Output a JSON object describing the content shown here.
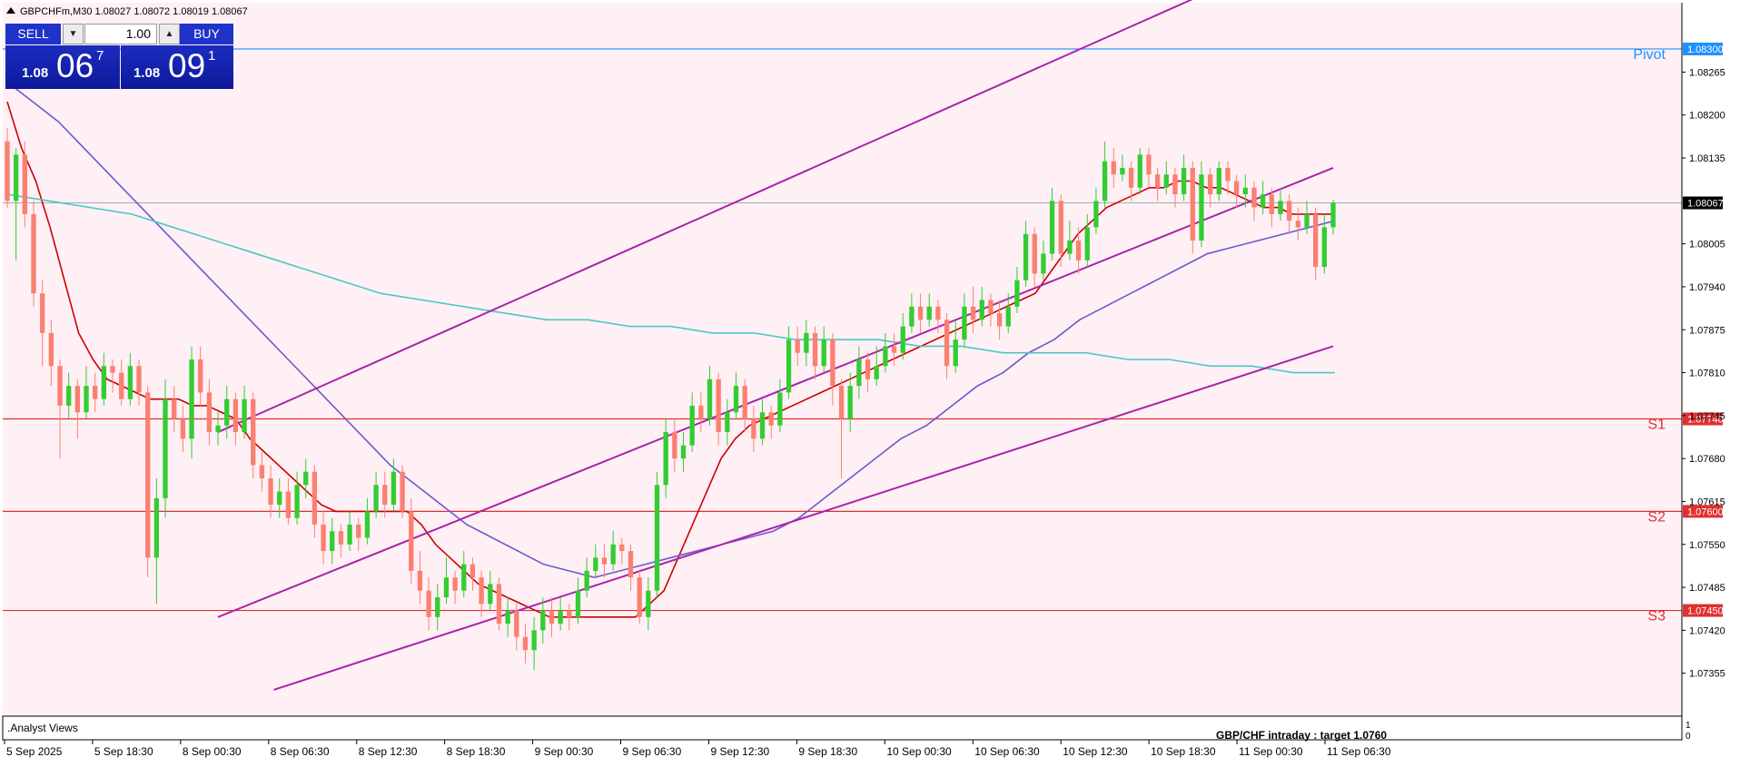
{
  "header": {
    "text": "GBPCHFm,M30  1.08027 1.08072 1.08019 1.08067"
  },
  "trade_panel": {
    "sell_label": "SELL",
    "buy_label": "BUY",
    "lot_value": "1.00",
    "bid_small": "1.08",
    "bid_big": "06",
    "bid_super": "7",
    "ask_small": "1.08",
    "ask_big": "09",
    "ask_super": "1"
  },
  "indicator_panel": {
    "title": ".Analyst Views",
    "annotation": "GBP/CHF intraday :   target 1.0760",
    "scale_top": "1",
    "scale_bottom": "0"
  },
  "colors": {
    "background": "#fff0f5",
    "bull": "#32cd32",
    "bear": "#fa8072",
    "ma_fast": "#cc0000",
    "ma_mid": "#6a5acd",
    "ma_slow": "#48c9c2",
    "channel": "#aa22aa",
    "level": "#e03030",
    "pivot": "#1e90ff",
    "grid": "#a0b0a8"
  },
  "chart_data": {
    "type": "candlestick",
    "symbol": "GBPCHFm,M30",
    "ylim": [
      1.0729,
      1.0837
    ],
    "y_ticks": [
      "1.08265",
      "1.08200",
      "1.08135",
      "1.08005",
      "1.07940",
      "1.07875",
      "1.07810",
      "1.07745",
      "1.07680",
      "1.07615",
      "1.07550",
      "1.07485",
      "1.07420",
      "1.07355"
    ],
    "x_ticks": [
      "5 Sep 2025",
      "5 Sep 18:30",
      "8 Sep 00:30",
      "8 Sep 06:30",
      "8 Sep 12:30",
      "8 Sep 18:30",
      "9 Sep 00:30",
      "9 Sep 06:30",
      "9 Sep 12:30",
      "9 Sep 18:30",
      "10 Sep 00:30",
      "10 Sep 06:30",
      "10 Sep 12:30",
      "10 Sep 18:30",
      "11 Sep 00:30",
      "11 Sep 06:30"
    ],
    "levels": [
      {
        "name": "Pivot",
        "value": 1.083,
        "label": "1.08300"
      },
      {
        "name": "S1",
        "value": 1.0774,
        "label": "1.07740"
      },
      {
        "name": "S2",
        "value": 1.076,
        "label": "1.07600"
      },
      {
        "name": "S3",
        "value": 1.0745,
        "label": "1.07450"
      }
    ],
    "current_price": {
      "value": 1.08067,
      "label": "1.08067"
    },
    "candles": [
      [
        1.0816,
        1.0807,
        1.0818,
        1.0806
      ],
      [
        1.0807,
        1.0814,
        1.0815,
        1.0798
      ],
      [
        1.0814,
        1.0805,
        1.0816,
        1.0803
      ],
      [
        1.0805,
        1.0793,
        1.0807,
        1.0791
      ],
      [
        1.0793,
        1.0787,
        1.0795,
        1.0782
      ],
      [
        1.0787,
        1.0782,
        1.0789,
        1.0779
      ],
      [
        1.0782,
        1.0776,
        1.0783,
        1.0768
      ],
      [
        1.0776,
        1.0779,
        1.0781,
        1.0774
      ],
      [
        1.0779,
        1.0775,
        1.078,
        1.0771
      ],
      [
        1.0775,
        1.0779,
        1.0782,
        1.0774
      ],
      [
        1.0779,
        1.0777,
        1.0781,
        1.0775
      ],
      [
        1.0777,
        1.0782,
        1.0784,
        1.0776
      ],
      [
        1.0782,
        1.0781,
        1.0783,
        1.0778
      ],
      [
        1.0781,
        1.0777,
        1.0783,
        1.0776
      ],
      [
        1.0777,
        1.0782,
        1.0784,
        1.0776
      ],
      [
        1.0782,
        1.0778,
        1.0783,
        1.0776
      ],
      [
        1.0778,
        1.0753,
        1.0779,
        1.075
      ],
      [
        1.0753,
        1.0762,
        1.0765,
        1.0746
      ],
      [
        1.0762,
        1.0777,
        1.078,
        1.0759
      ],
      [
        1.0777,
        1.0774,
        1.0779,
        1.0772
      ],
      [
        1.0774,
        1.0771,
        1.0776,
        1.0769
      ],
      [
        1.0771,
        1.0783,
        1.0785,
        1.0768
      ],
      [
        1.0783,
        1.0778,
        1.0785,
        1.0776
      ],
      [
        1.0778,
        1.0772,
        1.078,
        1.077
      ],
      [
        1.0772,
        1.0773,
        1.0775,
        1.077
      ],
      [
        1.0773,
        1.0777,
        1.0779,
        1.0771
      ],
      [
        1.0777,
        1.0772,
        1.0778,
        1.077
      ],
      [
        1.0772,
        1.0777,
        1.0779,
        1.0771
      ],
      [
        1.0777,
        1.0767,
        1.0778,
        1.0765
      ],
      [
        1.0767,
        1.0765,
        1.0769,
        1.0763
      ],
      [
        1.0765,
        1.0761,
        1.0767,
        1.0759
      ],
      [
        1.0761,
        1.0763,
        1.0765,
        1.0759
      ],
      [
        1.0763,
        1.0759,
        1.0765,
        1.0758
      ],
      [
        1.0759,
        1.0764,
        1.0766,
        1.0758
      ],
      [
        1.0764,
        1.0766,
        1.0768,
        1.0762
      ],
      [
        1.0766,
        1.0758,
        1.0767,
        1.0756
      ],
      [
        1.0758,
        1.0754,
        1.076,
        1.0752
      ],
      [
        1.0754,
        1.0757,
        1.0759,
        1.0752
      ],
      [
        1.0757,
        1.0755,
        1.0758,
        1.0753
      ],
      [
        1.0755,
        1.0758,
        1.076,
        1.0754
      ],
      [
        1.0758,
        1.0756,
        1.0759,
        1.0754
      ],
      [
        1.0756,
        1.076,
        1.0762,
        1.0755
      ],
      [
        1.076,
        1.0764,
        1.0766,
        1.0759
      ],
      [
        1.0764,
        1.0761,
        1.0766,
        1.0759
      ],
      [
        1.0761,
        1.0766,
        1.0768,
        1.076
      ],
      [
        1.0766,
        1.076,
        1.0767,
        1.0759
      ],
      [
        1.076,
        1.0751,
        1.0762,
        1.0749
      ],
      [
        1.0751,
        1.0748,
        1.0754,
        1.0746
      ],
      [
        1.0748,
        1.0744,
        1.075,
        1.0742
      ],
      [
        1.0744,
        1.0747,
        1.0749,
        1.0742
      ],
      [
        1.0747,
        1.075,
        1.0753,
        1.0746
      ],
      [
        1.075,
        1.0748,
        1.0751,
        1.0746
      ],
      [
        1.0748,
        1.0752,
        1.0754,
        1.0747
      ],
      [
        1.0752,
        1.075,
        1.0753,
        1.0748
      ],
      [
        1.075,
        1.0746,
        1.0751,
        1.0744
      ],
      [
        1.0746,
        1.0749,
        1.0751,
        1.0745
      ],
      [
        1.0749,
        1.0743,
        1.075,
        1.0742
      ],
      [
        1.0743,
        1.0745,
        1.0747,
        1.0741
      ],
      [
        1.0745,
        1.0741,
        1.0746,
        1.0739
      ],
      [
        1.0741,
        1.0739,
        1.0743,
        1.0737
      ],
      [
        1.0739,
        1.0742,
        1.0744,
        1.0736
      ],
      [
        1.0742,
        1.0745,
        1.0747,
        1.074
      ],
      [
        1.0745,
        1.0743,
        1.0747,
        1.0741
      ],
      [
        1.0743,
        1.0745,
        1.0747,
        1.0742
      ],
      [
        1.0745,
        1.0744,
        1.0746,
        1.0742
      ],
      [
        1.0744,
        1.0748,
        1.075,
        1.0743
      ],
      [
        1.0748,
        1.0751,
        1.0753,
        1.0747
      ],
      [
        1.0751,
        1.0753,
        1.0755,
        1.075
      ],
      [
        1.0753,
        1.0752,
        1.0755,
        1.075
      ],
      [
        1.0752,
        1.0755,
        1.0757,
        1.0751
      ],
      [
        1.0755,
        1.0754,
        1.0756,
        1.0752
      ],
      [
        1.0754,
        1.075,
        1.0755,
        1.0748
      ],
      [
        1.075,
        1.0744,
        1.0751,
        1.0743
      ],
      [
        1.0744,
        1.0748,
        1.075,
        1.0742
      ],
      [
        1.0748,
        1.0764,
        1.0766,
        1.0747
      ],
      [
        1.0764,
        1.0772,
        1.0774,
        1.0762
      ],
      [
        1.0772,
        1.0768,
        1.0774,
        1.0766
      ],
      [
        1.0768,
        1.077,
        1.0772,
        1.0766
      ],
      [
        1.077,
        1.0776,
        1.0778,
        1.0769
      ],
      [
        1.0776,
        1.0774,
        1.0778,
        1.0772
      ],
      [
        1.0774,
        1.078,
        1.0782,
        1.0773
      ],
      [
        1.078,
        1.0772,
        1.0781,
        1.077
      ],
      [
        1.0772,
        1.0775,
        1.0777,
        1.077
      ],
      [
        1.0775,
        1.0779,
        1.0781,
        1.0774
      ],
      [
        1.0779,
        1.0774,
        1.078,
        1.0772
      ],
      [
        1.0774,
        1.0771,
        1.0776,
        1.0769
      ],
      [
        1.0771,
        1.0775,
        1.0777,
        1.077
      ],
      [
        1.0775,
        1.0773,
        1.0776,
        1.0771
      ],
      [
        1.0773,
        1.0778,
        1.078,
        1.0772
      ],
      [
        1.0778,
        1.0786,
        1.0788,
        1.0777
      ],
      [
        1.0786,
        1.0784,
        1.0788,
        1.0782
      ],
      [
        1.0784,
        1.0787,
        1.0789,
        1.0782
      ],
      [
        1.0787,
        1.0782,
        1.0788,
        1.078
      ],
      [
        1.0782,
        1.0786,
        1.0788,
        1.0781
      ],
      [
        1.0786,
        1.0779,
        1.0787,
        1.0776
      ],
      [
        1.0779,
        1.0774,
        1.078,
        1.0765
      ],
      [
        1.0774,
        1.0779,
        1.0781,
        1.0772
      ],
      [
        1.0779,
        1.0783,
        1.0785,
        1.0777
      ],
      [
        1.0783,
        1.078,
        1.0784,
        1.0778
      ],
      [
        1.078,
        1.0782,
        1.0785,
        1.0779
      ],
      [
        1.0782,
        1.0785,
        1.0787,
        1.0781
      ],
      [
        1.0785,
        1.0784,
        1.0787,
        1.0782
      ],
      [
        1.0784,
        1.0788,
        1.079,
        1.0783
      ],
      [
        1.0788,
        1.0791,
        1.0793,
        1.0787
      ],
      [
        1.0791,
        1.0789,
        1.0793,
        1.0787
      ],
      [
        1.0789,
        1.0791,
        1.0793,
        1.0788
      ],
      [
        1.0791,
        1.0789,
        1.0792,
        1.0787
      ],
      [
        1.0789,
        1.0782,
        1.079,
        1.078
      ],
      [
        1.0782,
        1.0786,
        1.0789,
        1.0781
      ],
      [
        1.0786,
        1.0791,
        1.0793,
        1.0785
      ],
      [
        1.0791,
        1.0789,
        1.0794,
        1.0787
      ],
      [
        1.0789,
        1.0792,
        1.0794,
        1.0788
      ],
      [
        1.0792,
        1.079,
        1.0793,
        1.0788
      ],
      [
        1.079,
        1.0788,
        1.0792,
        1.0786
      ],
      [
        1.0788,
        1.0791,
        1.0793,
        1.0787
      ],
      [
        1.0791,
        1.0795,
        1.0797,
        1.079
      ],
      [
        1.0795,
        1.0802,
        1.0804,
        1.0794
      ],
      [
        1.0802,
        1.0796,
        1.0803,
        1.0794
      ],
      [
        1.0796,
        1.0799,
        1.0801,
        1.0795
      ],
      [
        1.0799,
        1.0807,
        1.0809,
        1.0798
      ],
      [
        1.0807,
        1.0799,
        1.0808,
        1.0797
      ],
      [
        1.0799,
        1.0801,
        1.0804,
        1.0798
      ],
      [
        1.0801,
        1.0798,
        1.0803,
        1.0796
      ],
      [
        1.0798,
        1.0803,
        1.0805,
        1.0797
      ],
      [
        1.0803,
        1.0807,
        1.0809,
        1.0802
      ],
      [
        1.0807,
        1.0813,
        1.0816,
        1.0806
      ],
      [
        1.0813,
        1.0811,
        1.0815,
        1.0809
      ],
      [
        1.0811,
        1.0812,
        1.0814,
        1.081
      ],
      [
        1.0812,
        1.0809,
        1.0813,
        1.0807
      ],
      [
        1.0809,
        1.0814,
        1.0815,
        1.0808
      ],
      [
        1.0814,
        1.0811,
        1.0815,
        1.0809
      ],
      [
        1.0811,
        1.0809,
        1.0812,
        1.0807
      ],
      [
        1.0809,
        1.0811,
        1.0813,
        1.0808
      ],
      [
        1.0811,
        1.0808,
        1.0812,
        1.0806
      ],
      [
        1.0808,
        1.0812,
        1.0814,
        1.0807
      ],
      [
        1.0812,
        1.0801,
        1.0813,
        1.0799
      ],
      [
        1.0801,
        1.0811,
        1.0813,
        1.08
      ],
      [
        1.0811,
        1.0808,
        1.0812,
        1.0806
      ],
      [
        1.0808,
        1.0812,
        1.0813,
        1.0807
      ],
      [
        1.0812,
        1.081,
        1.0813,
        1.0808
      ],
      [
        1.081,
        1.0808,
        1.0811,
        1.0806
      ],
      [
        1.0808,
        1.0809,
        1.0811,
        1.0806
      ],
      [
        1.0809,
        1.0806,
        1.081,
        1.0804
      ],
      [
        1.0806,
        1.0808,
        1.081,
        1.0805
      ],
      [
        1.0808,
        1.0805,
        1.0809,
        1.0803
      ],
      [
        1.0805,
        1.0807,
        1.0809,
        1.0804
      ],
      [
        1.0807,
        1.0804,
        1.0808,
        1.0802
      ],
      [
        1.0804,
        1.0803,
        1.0806,
        1.0801
      ],
      [
        1.0803,
        1.0805,
        1.0807,
        1.0802
      ],
      [
        1.0805,
        1.0797,
        1.0806,
        1.0795
      ],
      [
        1.0797,
        1.0803,
        1.0805,
        1.0796
      ],
      [
        1.0803,
        1.08067,
        1.08072,
        1.08019
      ]
    ],
    "moving_averages": [
      {
        "color": "#cc0000",
        "values": [
          1.0822,
          1.0815,
          1.081,
          1.0803,
          1.0795,
          1.0787,
          1.0783,
          1.078,
          1.0779,
          1.0778,
          1.0777,
          1.0777,
          1.0777,
          1.0776,
          1.0776,
          1.0775,
          1.0774,
          1.0771,
          1.0769,
          1.0767,
          1.0765,
          1.0763,
          1.0761,
          1.076,
          1.076,
          1.076,
          1.076,
          1.076,
          1.076,
          1.0758,
          1.0755,
          1.0753,
          1.0751,
          1.0749,
          1.0748,
          1.0747,
          1.0746,
          1.0745,
          1.0744,
          1.0744,
          1.0744,
          1.0744,
          1.0744,
          1.0744,
          1.0744,
          1.0746,
          1.0748,
          1.0753,
          1.0758,
          1.0763,
          1.0768,
          1.0771,
          1.0773,
          1.0774,
          1.0775,
          1.0776,
          1.0777,
          1.0778,
          1.0779,
          1.078,
          1.0781,
          1.0782,
          1.0783,
          1.0784,
          1.0785,
          1.0786,
          1.0787,
          1.0788,
          1.0789,
          1.079,
          1.0791,
          1.0792,
          1.0793,
          1.0796,
          1.0799,
          1.0802,
          1.0804,
          1.0806,
          1.0807,
          1.0808,
          1.0809,
          1.0809,
          1.081,
          1.081,
          1.0809,
          1.0809,
          1.0808,
          1.0807,
          1.0806,
          1.0806,
          1.0805,
          1.0805,
          1.0805,
          1.0805
        ]
      },
      {
        "color": "#6a5acd",
        "values": [
          1.0825,
          1.0822,
          1.0819,
          1.0815,
          1.0811,
          1.0807,
          1.0803,
          1.0799,
          1.0795,
          1.0791,
          1.0787,
          1.0783,
          1.0779,
          1.0775,
          1.0771,
          1.0767,
          1.0764,
          1.0761,
          1.0758,
          1.0756,
          1.0754,
          1.0752,
          1.0751,
          1.075,
          1.0751,
          1.0752,
          1.0753,
          1.0754,
          1.0755,
          1.0756,
          1.0757,
          1.0759,
          1.0762,
          1.0765,
          1.0768,
          1.0771,
          1.0773,
          1.0776,
          1.0779,
          1.0781,
          1.0784,
          1.0786,
          1.0789,
          1.0791,
          1.0793,
          1.0795,
          1.0797,
          1.0799,
          1.08,
          1.0801,
          1.0802,
          1.0803,
          1.0804
        ]
      },
      {
        "color": "#48c9c2",
        "values": [
          1.0808,
          1.0807,
          1.0806,
          1.0805,
          1.0803,
          1.0801,
          1.0799,
          1.0797,
          1.0795,
          1.0793,
          1.0792,
          1.0791,
          1.079,
          1.0789,
          1.0789,
          1.0788,
          1.0788,
          1.0787,
          1.0787,
          1.0786,
          1.0786,
          1.0786,
          1.0785,
          1.0785,
          1.0784,
          1.0784,
          1.0784,
          1.0783,
          1.0783,
          1.0782,
          1.0782,
          1.0781,
          1.0781
        ]
      }
    ],
    "channel_lines": [
      {
        "start": [
          0,
          1.0772
        ],
        "end": [
          1.0,
          1.0847
        ]
      },
      {
        "start": [
          0,
          1.0744
        ],
        "end": [
          1.0,
          1.0812
        ]
      },
      {
        "start": [
          0.05,
          1.0733
        ],
        "end": [
          1.0,
          1.0785
        ]
      }
    ],
    "axis_labels": [
      "S1",
      "S2",
      "S3",
      "Pivot"
    ]
  }
}
